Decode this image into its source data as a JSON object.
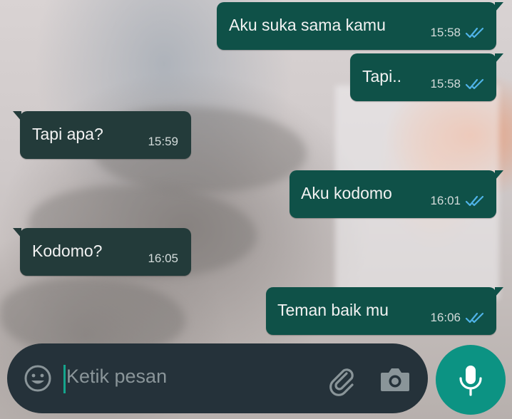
{
  "messages": [
    {
      "direction": "outgoing",
      "text": "Aku suka sama kamu",
      "time": "15:58",
      "status": "read"
    },
    {
      "direction": "outgoing",
      "text": "Tapi..",
      "time": "15:58",
      "status": "read"
    },
    {
      "direction": "incoming",
      "text": "Tapi apa?",
      "time": "15:59"
    },
    {
      "direction": "outgoing",
      "text": "Aku kodomo",
      "time": "16:01",
      "status": "read"
    },
    {
      "direction": "incoming",
      "text": "Kodomo?",
      "time": "16:05"
    },
    {
      "direction": "outgoing",
      "text": "Teman baik mu",
      "time": "16:06",
      "status": "read"
    }
  ],
  "composer": {
    "placeholder": "Ketik pesan",
    "emoji_icon": "emoji-icon",
    "attach_icon": "paperclip-icon",
    "camera_icon": "camera-icon",
    "mic_icon": "microphone-icon"
  },
  "colors": {
    "outgoing_bubble": "#0f5148",
    "incoming_bubble": "#233b3a",
    "read_ticks": "#4fb3e8",
    "mic_button": "#0c9383",
    "input_bar": "#25323a"
  }
}
